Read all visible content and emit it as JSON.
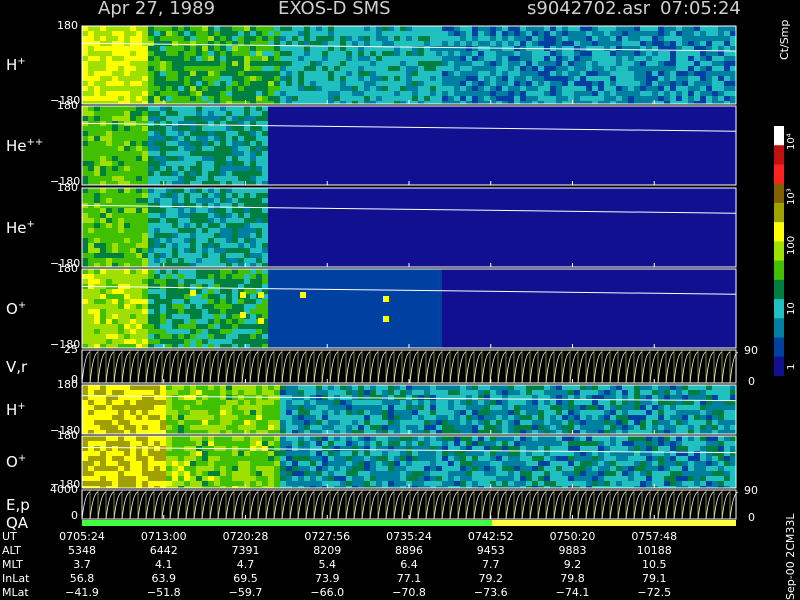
{
  "header": {
    "date": "Apr 27, 1989",
    "instrument": "EXOS-D SMS",
    "file": "s9042702.asr",
    "time": "07:05:24"
  },
  "unit_label": "Ct/Smp",
  "file_note": "Sep-00 2CM33L",
  "colorbar": {
    "ticks": [
      "10⁴",
      "10³",
      "100",
      "10",
      "1"
    ],
    "colors": [
      "#ffffff",
      "#c01010",
      "#ff2020",
      "#806000",
      "#a0a000",
      "#ffff00",
      "#a0e000",
      "#40c000",
      "#008040",
      "#20c0c0",
      "#0080a0",
      "#0040a0",
      "#101090"
    ]
  },
  "panels": [
    {
      "label": "H",
      "sup": "+",
      "top": "180",
      "bottom": "−180"
    },
    {
      "label": "He",
      "sup": "++",
      "top": "180",
      "bottom": "−180"
    },
    {
      "label": "He",
      "sup": "+",
      "top": "180",
      "bottom": "−180"
    },
    {
      "label": "O",
      "sup": "+",
      "top": "180",
      "bottom": "−180"
    },
    {
      "label": "V,r",
      "sup": "",
      "top": "25",
      "bottom": "0",
      "rtop": "90",
      "rbottom": "0"
    },
    {
      "label": "H",
      "sup": "+",
      "top": "180",
      "bottom": "−180"
    },
    {
      "label": "O",
      "sup": "+",
      "top": "180",
      "bottom": "−180"
    },
    {
      "label": "E,p",
      "sup": "",
      "top": "4000",
      "bottom": "0",
      "rtop": "90",
      "rbottom": "0"
    },
    {
      "label": "QA",
      "sup": "",
      "top": "",
      "bottom": ""
    }
  ],
  "footer": {
    "labels": [
      "UT",
      "ALT",
      "MLT",
      "InLat",
      "MLat"
    ],
    "columns": [
      [
        "0705:24",
        "5348",
        "3.7",
        "56.8",
        "−41.9"
      ],
      [
        "0713:00",
        "6442",
        "4.1",
        "63.9",
        "−51.8"
      ],
      [
        "0720:28",
        "7391",
        "4.7",
        "69.5",
        "−59.7"
      ],
      [
        "0727:56",
        "8209",
        "5.4",
        "73.9",
        "−66.0"
      ],
      [
        "0735:24",
        "8896",
        "6.4",
        "77.1",
        "−70.8"
      ],
      [
        "0742:52",
        "9453",
        "7.7",
        "79.2",
        "−73.6"
      ],
      [
        "0750:20",
        "9883",
        "9.2",
        "79.8",
        "−74.1"
      ],
      [
        "0757:48",
        "10188",
        "10.5",
        "79.1",
        "−72.5"
      ]
    ]
  },
  "chart_data": {
    "type": "heatmap",
    "title": "Apr 27, 1989 EXOS-D SMS",
    "x": [
      "0705:24",
      "0713:00",
      "0720:28",
      "0727:56",
      "0735:24",
      "0742:52",
      "0750:20",
      "0757:48"
    ],
    "series": [
      {
        "name": "H+",
        "ylim": [
          -180,
          180
        ]
      },
      {
        "name": "He++",
        "ylim": [
          -180,
          180
        ]
      },
      {
        "name": "He+",
        "ylim": [
          -180,
          180
        ]
      },
      {
        "name": "O+",
        "ylim": [
          -180,
          180
        ]
      },
      {
        "name": "V,r",
        "ylim": [
          0,
          25
        ]
      },
      {
        "name": "H+",
        "ylim": [
          -180,
          180
        ]
      },
      {
        "name": "O+",
        "ylim": [
          -180,
          180
        ]
      },
      {
        "name": "E,p",
        "ylim": [
          0,
          4000
        ]
      },
      {
        "name": "QA"
      }
    ],
    "color_scale": "log",
    "color_range": [
      1,
      10000
    ],
    "legend": "right"
  }
}
